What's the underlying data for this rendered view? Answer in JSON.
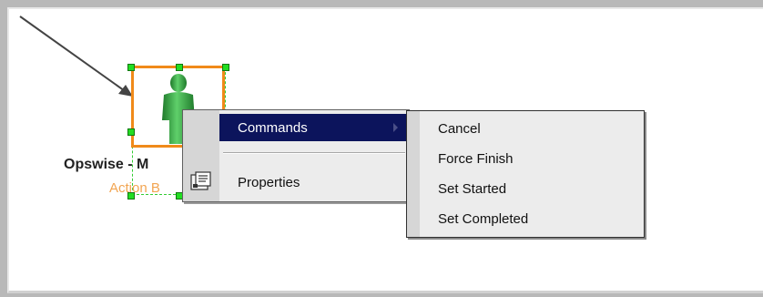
{
  "node": {
    "title": "Opswise - M",
    "subtitle": "Action B",
    "icon": "person-icon"
  },
  "context_menu": {
    "items": [
      {
        "label": "Commands",
        "has_submenu": true,
        "highlighted": true,
        "icon": null
      },
      {
        "label": "Properties",
        "has_submenu": false,
        "highlighted": false,
        "icon": "properties-icon"
      }
    ]
  },
  "submenu": {
    "items": [
      {
        "label": "Cancel"
      },
      {
        "label": "Force Finish"
      },
      {
        "label": "Set Started"
      },
      {
        "label": "Set Completed"
      }
    ]
  },
  "colors": {
    "frame": "#b8b8b8",
    "selection_border": "#f08a1a",
    "handle": "#22dd22",
    "menu_highlight": "#0c145c",
    "subtitle": "#f2a552",
    "icon_green": "#2e9b3c"
  }
}
